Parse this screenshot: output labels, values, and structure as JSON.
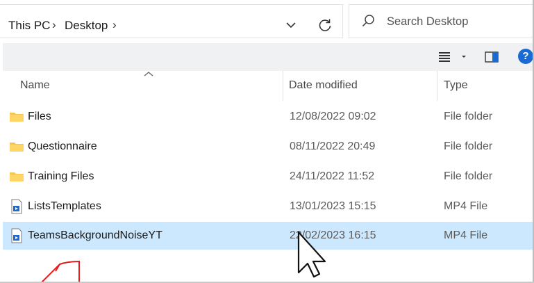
{
  "breadcrumb": {
    "items": [
      "This PC",
      "Desktop"
    ],
    "separator": "›"
  },
  "search": {
    "placeholder": "Search Desktop"
  },
  "toolbar": {
    "help_label": "?"
  },
  "columns": {
    "name": "Name",
    "date_modified": "Date modified",
    "type": "Type"
  },
  "files": [
    {
      "name": "Files",
      "date": "12/08/2022 09:02",
      "type": "File folder",
      "icon": "folder-icon"
    },
    {
      "name": "Questionnaire",
      "date": "08/11/2022 20:49",
      "type": "File folder",
      "icon": "folder-icon"
    },
    {
      "name": "Training Files",
      "date": "24/11/2022 11:52",
      "type": "File folder",
      "icon": "folder-icon"
    },
    {
      "name": "ListsTemplates",
      "date": "13/01/2023 15:15",
      "type": "MP4 File",
      "icon": "video-file-icon"
    },
    {
      "name": "TeamsBackgroundNoiseYT",
      "date": "22/02/2023 16:15",
      "type": "MP4 File",
      "icon": "video-file-icon",
      "selected": true
    }
  ],
  "colors": {
    "selection": "#cce8ff",
    "folder": "#f5c451",
    "accent": "#1b6ad1",
    "annotation": "#e02020"
  }
}
